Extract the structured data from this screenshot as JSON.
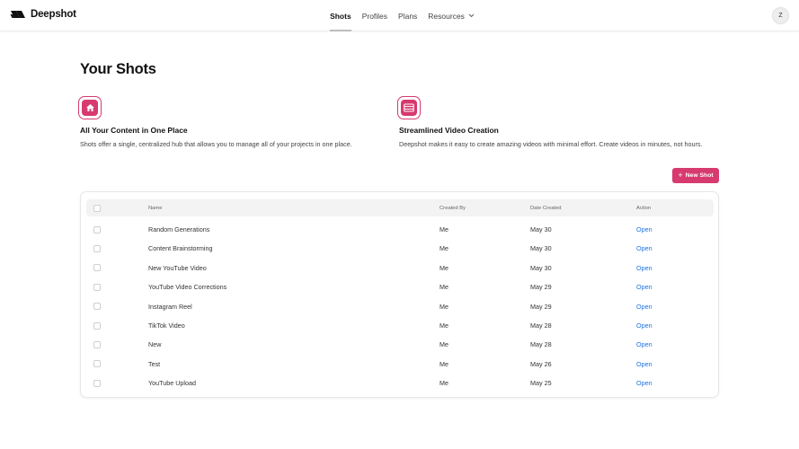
{
  "app": {
    "logo_text": "Deepshot",
    "accent_color": "#d63a6e",
    "link_color": "#1a73e8"
  },
  "nav": {
    "items": [
      {
        "label": "Shots",
        "active": true
      },
      {
        "label": "Profiles",
        "active": false
      },
      {
        "label": "Plans",
        "active": false
      },
      {
        "label": "Resources",
        "active": false,
        "dropdown": true
      }
    ]
  },
  "user": {
    "avatar_initial": "Z"
  },
  "page": {
    "title": "Your Shots"
  },
  "features": [
    {
      "icon": "home-icon",
      "title": "All Your Content in One Place",
      "description": "Shots offer a single, centralized hub that allows you to manage all of your projects in one place."
    },
    {
      "icon": "film-icon",
      "title": "Streamlined Video Creation",
      "description": "Deepshot makes it easy to create amazing videos with minimal effort. Create videos in minutes, not hours."
    }
  ],
  "actions": {
    "new_shot_label": "New Shot",
    "new_shot_icon": "plus-icon"
  },
  "table": {
    "columns": {
      "name": "Name",
      "created_by": "Created By",
      "date_created": "Date Created",
      "action": "Action"
    },
    "rows": [
      {
        "name": "Random Generations",
        "created_by": "Me",
        "date_created": "May 30",
        "action": "Open"
      },
      {
        "name": "Content Brainstorming",
        "created_by": "Me",
        "date_created": "May 30",
        "action": "Open"
      },
      {
        "name": "New YouTube Video",
        "created_by": "Me",
        "date_created": "May 30",
        "action": "Open"
      },
      {
        "name": "YouTube Video Corrections",
        "created_by": "Me",
        "date_created": "May 29",
        "action": "Open"
      },
      {
        "name": "Instagram Reel",
        "created_by": "Me",
        "date_created": "May 29",
        "action": "Open"
      },
      {
        "name": "TikTok Video",
        "created_by": "Me",
        "date_created": "May 28",
        "action": "Open"
      },
      {
        "name": "New",
        "created_by": "Me",
        "date_created": "May 28",
        "action": "Open"
      },
      {
        "name": "Test",
        "created_by": "Me",
        "date_created": "May 26",
        "action": "Open"
      },
      {
        "name": "YouTube Upload",
        "created_by": "Me",
        "date_created": "May 25",
        "action": "Open"
      }
    ]
  }
}
